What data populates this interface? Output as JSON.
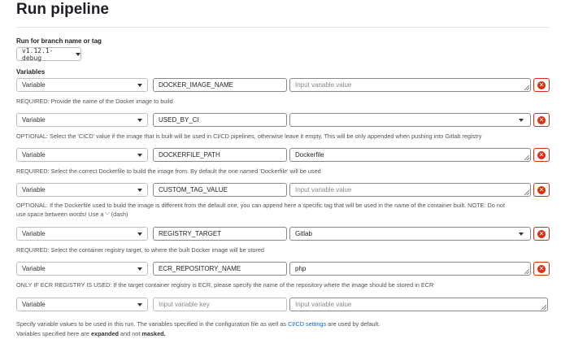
{
  "page": {
    "title": "Run pipeline"
  },
  "branch": {
    "label": "Run for branch name or tag",
    "value": "v1.12.1-debug"
  },
  "variables_label": "Variables",
  "variables": [
    {
      "type": "Variable",
      "key": "DOCKER_IMAGE_NAME",
      "value": "",
      "value_placeholder": "Input variable value",
      "help": "REQUIRED: Provide the name of the Docker image to build"
    },
    {
      "type": "Variable",
      "key": "USED_BY_CI",
      "value": "",
      "value_is_select": true,
      "help": "OPTIONAL: Select the 'CICD' value if the image that is built will be used in CI/CD pipelines, otherwise leave it empty. This will be only appended when pushing into Gitlab registry"
    },
    {
      "type": "Variable",
      "key": "DOCKERFILE_PATH",
      "value": "Dockerfile",
      "help": "REQUIRED: Select the correct Dockerfile to build the image from. By default the one named 'Dockerfile' will be used"
    },
    {
      "type": "Variable",
      "key": "CUSTOM_TAG_VALUE",
      "value": "",
      "value_placeholder": "Input variable value",
      "help_line1": "OPTIONAL: If the Dockerfile used to build the image is different from the default one, you can append here a specific tag that will be used in the name of the container built. NOTE: Do not",
      "help_line2": "use space between words! Use a '-' (dash)"
    },
    {
      "type": "Variable",
      "key": "REGISTRY_TARGET",
      "value": "Gitlab",
      "value_is_select": true,
      "help": "REQUIRED: Select the container registry target, to where the built Docker image will be stored"
    },
    {
      "type": "Variable",
      "key": "ECR_REPOSITORY_NAME",
      "value": "php",
      "help": "ONLY IF ECR REGISTRY IS USED: If the target container registry is ECR, please specify the name of the repository where the image should be stored in ECR"
    },
    {
      "type": "Variable",
      "key": "",
      "key_placeholder": "Input variable key",
      "value": "",
      "value_placeholder": "Input variable value"
    }
  ],
  "footer": {
    "line1_pre": "Specify variable values to be used in this run. The variables specified in the configuration file as well as ",
    "line1_link": "CI/CD settings",
    "line1_post": " are used by default.",
    "line2_pre": "Variables specified here are ",
    "line2_b1": "expanded",
    "line2_mid": " and not ",
    "line2_b2": "masked."
  },
  "colors": {
    "remove": "#dd2b0e",
    "link": "#1068bf"
  },
  "icons": {
    "remove": "remove-icon",
    "dropdown": "chevron-down-icon"
  }
}
